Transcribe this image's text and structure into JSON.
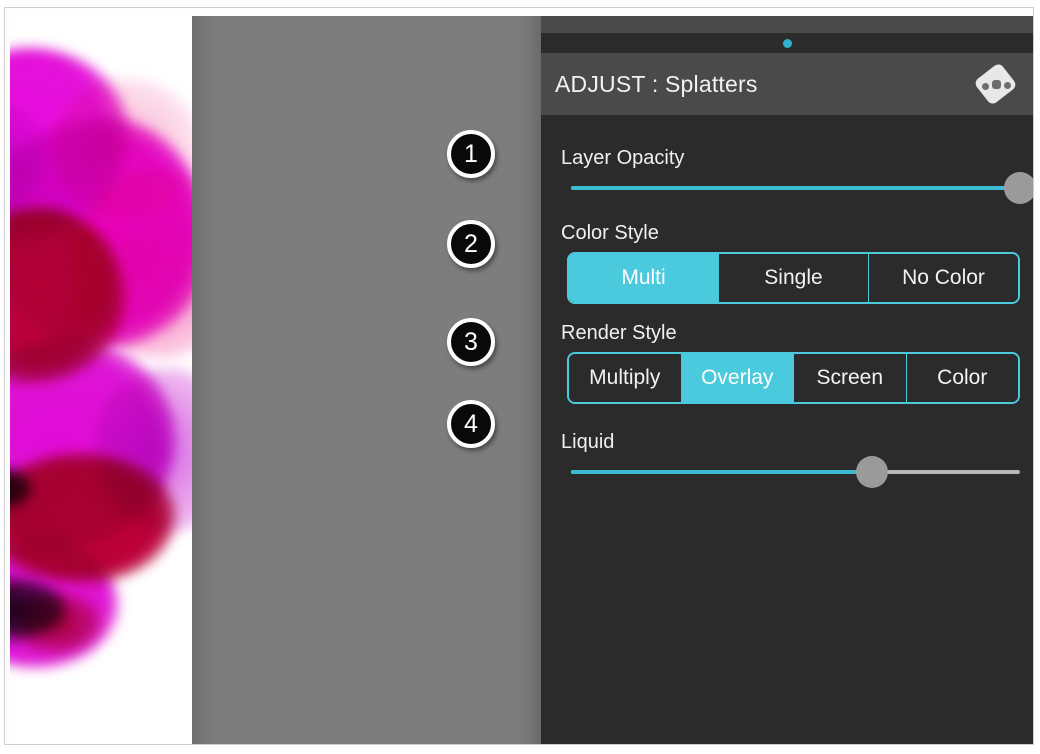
{
  "app": {
    "panel_title": "ADJUST : Splatters",
    "deck_icon": "cards-deck-icon",
    "page_indicator_color": "#2fb4cd",
    "accent_color": "#4ccadd",
    "panel_background": "#2b2b2b",
    "header_background": "#4a4a4a"
  },
  "artwork": {
    "name": "watercolor-splatter-artwork",
    "palette": [
      "#e90ae0",
      "#c4003f",
      "#f596c3",
      "#ffb03a",
      "#10100c",
      "#ffffff"
    ]
  },
  "callouts": [
    {
      "number": "1",
      "target": "Layer Opacity"
    },
    {
      "number": "2",
      "target": "Color Style"
    },
    {
      "number": "3",
      "target": "Render Style"
    },
    {
      "number": "4",
      "target": "Liquid"
    }
  ],
  "controls": {
    "layer_opacity": {
      "label": "Layer Opacity",
      "value_percent": 100,
      "fill_color": "#3bbcd2",
      "handle_color": "#9a9a9a"
    },
    "color_style": {
      "label": "Color Style",
      "options": [
        "Multi",
        "Single",
        "No Color"
      ],
      "selected": "Multi",
      "selected_index": 0
    },
    "render_style": {
      "label": "Render Style",
      "options": [
        "Multiply",
        "Overlay",
        "Screen",
        "Color"
      ],
      "selected": "Overlay",
      "selected_index": 1
    },
    "liquid": {
      "label": "Liquid",
      "value_percent": 67,
      "fill_color": "#3bbcd2",
      "handle_color": "#9a9a9a"
    }
  }
}
